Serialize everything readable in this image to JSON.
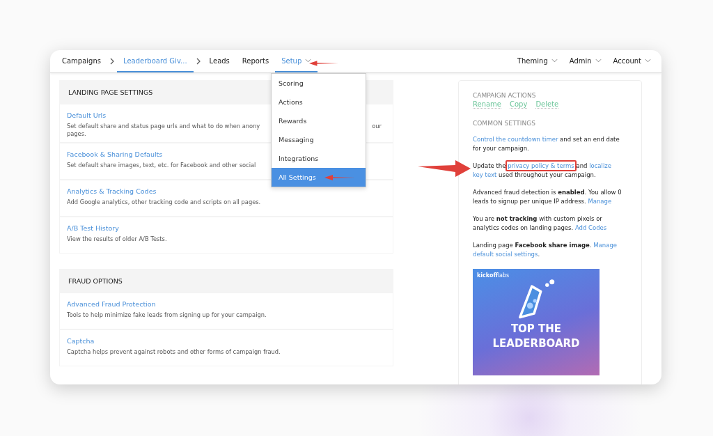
{
  "nav": {
    "left": [
      {
        "label": "Campaigns",
        "selected": false,
        "separator_after": true,
        "dropdown": false
      },
      {
        "label": "Leaderboard Giv...",
        "selected": true,
        "separator_after": true,
        "dropdown": false
      },
      {
        "label": "Leads",
        "selected": false,
        "separator_after": false,
        "dropdown": false
      },
      {
        "label": "Reports",
        "selected": false,
        "separator_after": false,
        "dropdown": false
      },
      {
        "label": "Setup",
        "selected": true,
        "separator_after": false,
        "dropdown": true
      }
    ],
    "right": [
      {
        "label": "Theming",
        "dropdown": true
      },
      {
        "label": "Admin",
        "dropdown": true
      },
      {
        "label": "Account",
        "dropdown": true
      }
    ]
  },
  "setup_menu": [
    {
      "label": "Scoring",
      "selected": false
    },
    {
      "label": "Actions",
      "selected": false
    },
    {
      "label": "Rewards",
      "selected": false
    },
    {
      "label": "Messaging",
      "selected": false
    },
    {
      "label": "Integrations",
      "selected": false
    },
    {
      "label": "All Settings",
      "selected": true
    }
  ],
  "sections": [
    {
      "title": "LANDING PAGE SETTINGS",
      "items": [
        {
          "title": "Default Urls",
          "description": "Set default share and status page urls and what to do when anony",
          "description_after": "our",
          "description_line2": "pages."
        },
        {
          "title": "Facebook & Sharing Defaults",
          "description": "Set default share images, text, etc. for Facebook and other social"
        },
        {
          "title": "Analytics & Tracking Codes",
          "description": "Add Google analytics, other tracking code and scripts on all pages."
        },
        {
          "title": "A/B Test History",
          "description": "View the results of older A/B Tests."
        }
      ]
    },
    {
      "title": "FRAUD OPTIONS",
      "items": [
        {
          "title": "Advanced Fraud Protection",
          "description": "Tools to help minimize fake leads from signing up for your campaign."
        },
        {
          "title": "Captcha",
          "description": "Captcha helps prevent against robots and other forms of campaign fraud."
        }
      ]
    }
  ],
  "sidebar": {
    "actions_title": "CAMPAIGN ACTIONS",
    "actions": [
      "Rename",
      "Copy",
      "Delete"
    ],
    "common_title": "COMMON SETTINGS",
    "paragraphs": [
      [
        {
          "kind": "link",
          "text": "Control the countdown timer"
        },
        {
          "kind": "text",
          "text": " and set an end date for your campaign."
        }
      ],
      [
        {
          "kind": "text",
          "text": "Update the "
        },
        {
          "kind": "link",
          "text": "privacy policy & terms",
          "highlighted": true
        },
        {
          "kind": "text",
          "text": " and "
        },
        {
          "kind": "link",
          "text": "localize"
        },
        {
          "kind": "link",
          "text": "key text"
        },
        {
          "kind": "text",
          "text": " used throughout your campaign."
        }
      ],
      [
        {
          "kind": "text",
          "text": "Advanced fraud detection is **enabled**. You allow 0 leads to signup per unique IP address. "
        },
        {
          "kind": "link",
          "text": "Manage"
        }
      ],
      [
        {
          "kind": "text",
          "text": "You are **not tracking** with custom pixels or analytics codes on landing pages. "
        },
        {
          "kind": "link",
          "text": "Add Codes"
        }
      ],
      [
        {
          "kind": "text",
          "text": "Landing page **Facebook share image**. "
        },
        {
          "kind": "link",
          "text": "Manage"
        },
        {
          "kind": "link",
          "text": "default social settings"
        },
        {
          "kind": "text",
          "text": "."
        }
      ]
    ],
    "share_image": {
      "brand_bold": "kickoff",
      "brand_light": "labs",
      "headline_1": "TOP THE",
      "headline_2": "LEADERBOARD"
    }
  }
}
